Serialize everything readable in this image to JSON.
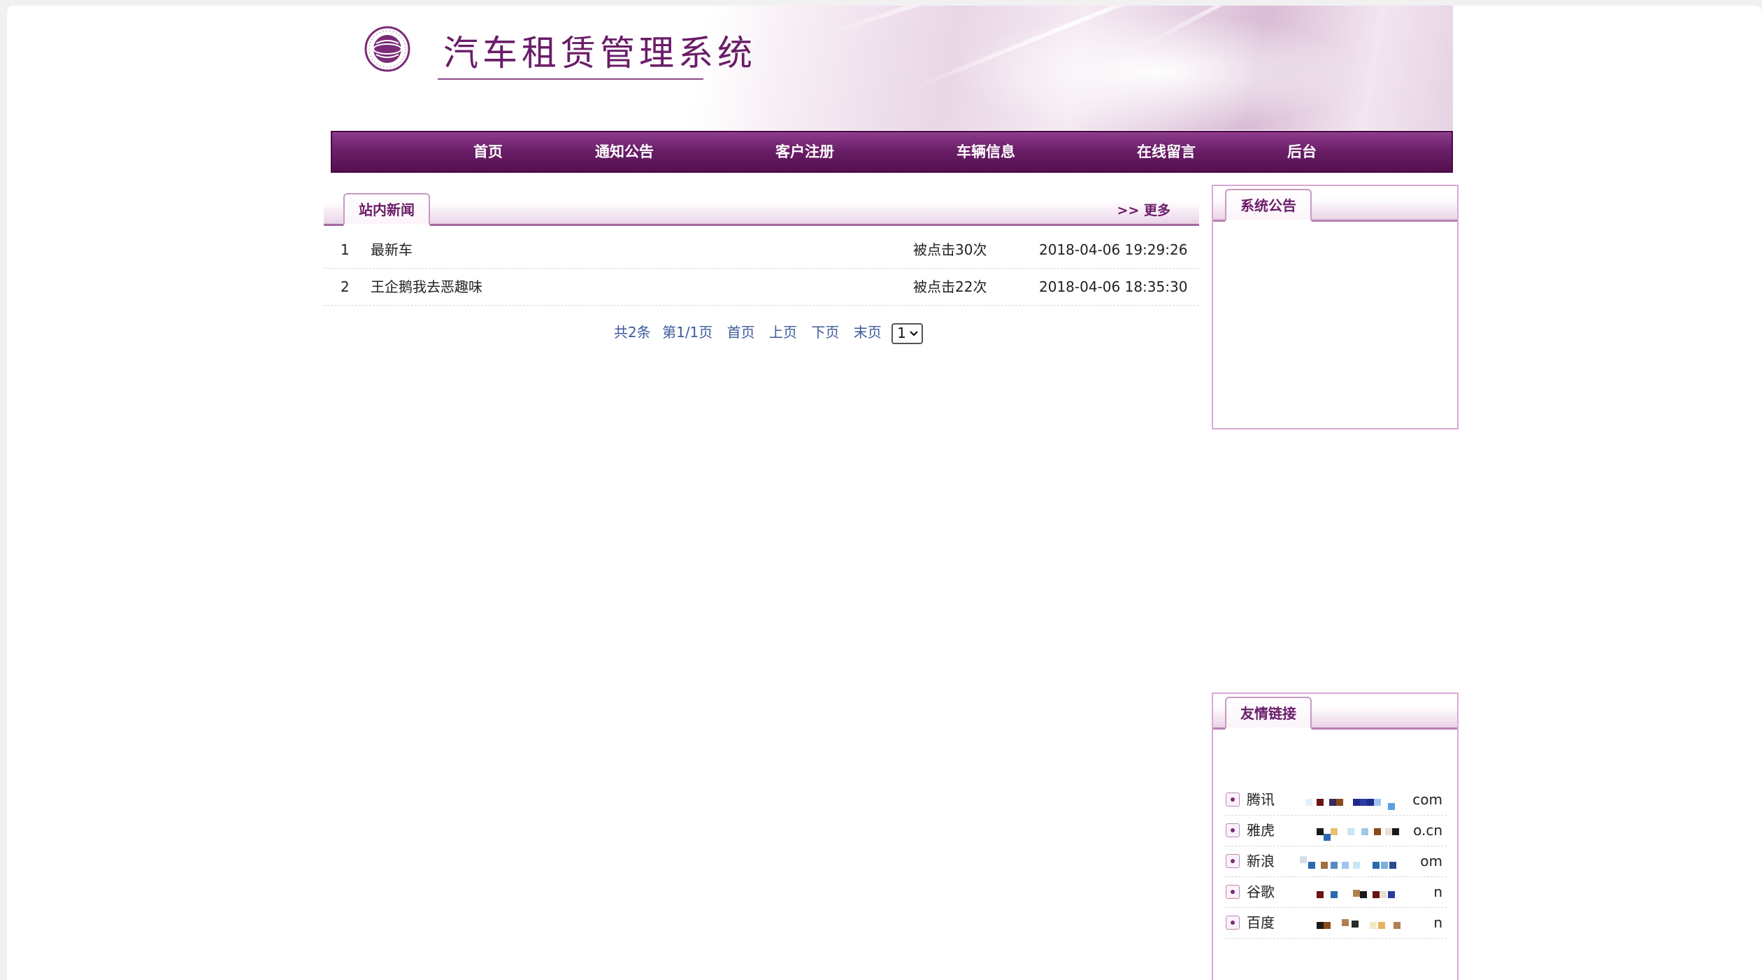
{
  "header": {
    "title": "汽车租赁管理系统"
  },
  "nav": {
    "items": [
      "首页",
      "通知公告",
      "客户注册",
      "车辆信息",
      "在线留言",
      "后台"
    ]
  },
  "news": {
    "tab_label": "站内新闻",
    "more_label": ">> 更多",
    "rows": [
      {
        "index": "1",
        "title": "最新车",
        "clicks": "被点击30次",
        "date": "2018-04-06 19:29:26"
      },
      {
        "index": "2",
        "title": "王企鹅我去恶趣味",
        "clicks": "被点击22次",
        "date": "2018-04-06 18:35:30"
      }
    ],
    "pager": {
      "total": "共2条",
      "page_info": "第1/1页",
      "first": "首页",
      "prev": "上页",
      "next": "下页",
      "last": "末页",
      "selected_page": "1"
    }
  },
  "announcement": {
    "tab_label": "系统公告"
  },
  "links": {
    "tab_label": "友情链接",
    "items": [
      {
        "name": "腾讯",
        "url_tail": "com"
      },
      {
        "name": "雅虎",
        "url_tail": "o.cn"
      },
      {
        "name": "新浪",
        "url_tail": "om"
      },
      {
        "name": "谷歌",
        "url_tail": "n"
      },
      {
        "name": "百度",
        "url_tail": "n"
      }
    ]
  },
  "colors": {
    "brand_purple": "#6a1c68",
    "nav_purple": "#6b1f69",
    "pager_blue": "#3b5a9a"
  }
}
